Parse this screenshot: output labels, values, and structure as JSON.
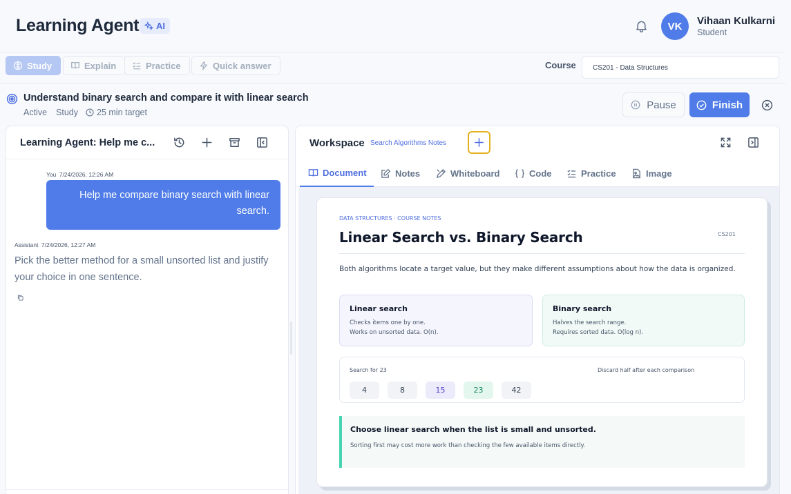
{
  "app": {
    "title": "Learning Agent",
    "ai_badge": "AI"
  },
  "user": {
    "initials": "VK",
    "name": "Vihaan Kulkarni",
    "role": "Student"
  },
  "modes": [
    {
      "label": "Study",
      "icon": "brain-icon",
      "active": true
    },
    {
      "label": "Explain",
      "icon": "book-icon",
      "active": false
    },
    {
      "label": "Practice",
      "icon": "checklist-icon",
      "active": false
    },
    {
      "label": "Quick answer",
      "icon": "bolt-icon",
      "active": false
    }
  ],
  "course": {
    "label": "Course",
    "value": "CS201 - Data Structures"
  },
  "goal": {
    "title": "Understand binary search and compare it with linear search",
    "status": "Active",
    "mode": "Study",
    "target": "25 min target",
    "pause_label": "Pause",
    "finish_label": "Finish"
  },
  "chat": {
    "title": "Learning Agent: Help me c...",
    "messages": [
      {
        "author": "You",
        "time": "7/24/2026, 12:26 AM",
        "text": "Help me compare binary search with linear search."
      },
      {
        "author": "Assistant",
        "time": "7/24/2026, 12:27 AM",
        "text": "Pick the better method for a small unsorted list and justify your choice in one sentence."
      }
    ]
  },
  "workspace": {
    "title": "Workspace",
    "subtitle": "Search Algorithms Notes",
    "tabs": [
      "Document",
      "Notes",
      "Whiteboard",
      "Code",
      "Practice",
      "Image"
    ],
    "active_tab": "Document"
  },
  "document": {
    "eyebrow": "DATA STRUCTURES · COURSE NOTES",
    "code": "CS201",
    "title": "Linear Search vs. Binary Search",
    "intro": "Both algorithms locate a target value, but they make different assumptions about how the data is organized.",
    "linear": {
      "heading": "Linear search",
      "line1": "Checks items one by one.",
      "line2": "Works on unsorted data. O(n)."
    },
    "binary": {
      "heading": "Binary search",
      "line1": "Halves the search range.",
      "line2": "Requires sorted data. O(log n)."
    },
    "search_demo": {
      "label": "Search for 23",
      "hint": "Discard half after each comparison",
      "values": [
        "4",
        "8",
        "15",
        "23",
        "42"
      ],
      "midpoint": "15",
      "found": "23"
    },
    "callout": {
      "heading": "Choose linear search when the list is small and unsorted.",
      "text": "Sorting first may cost more work than checking the few available items directly."
    }
  },
  "colors": {
    "accent": "#4f7ce8",
    "success": "#47d4b2",
    "warning_outline": "#e5b020"
  }
}
